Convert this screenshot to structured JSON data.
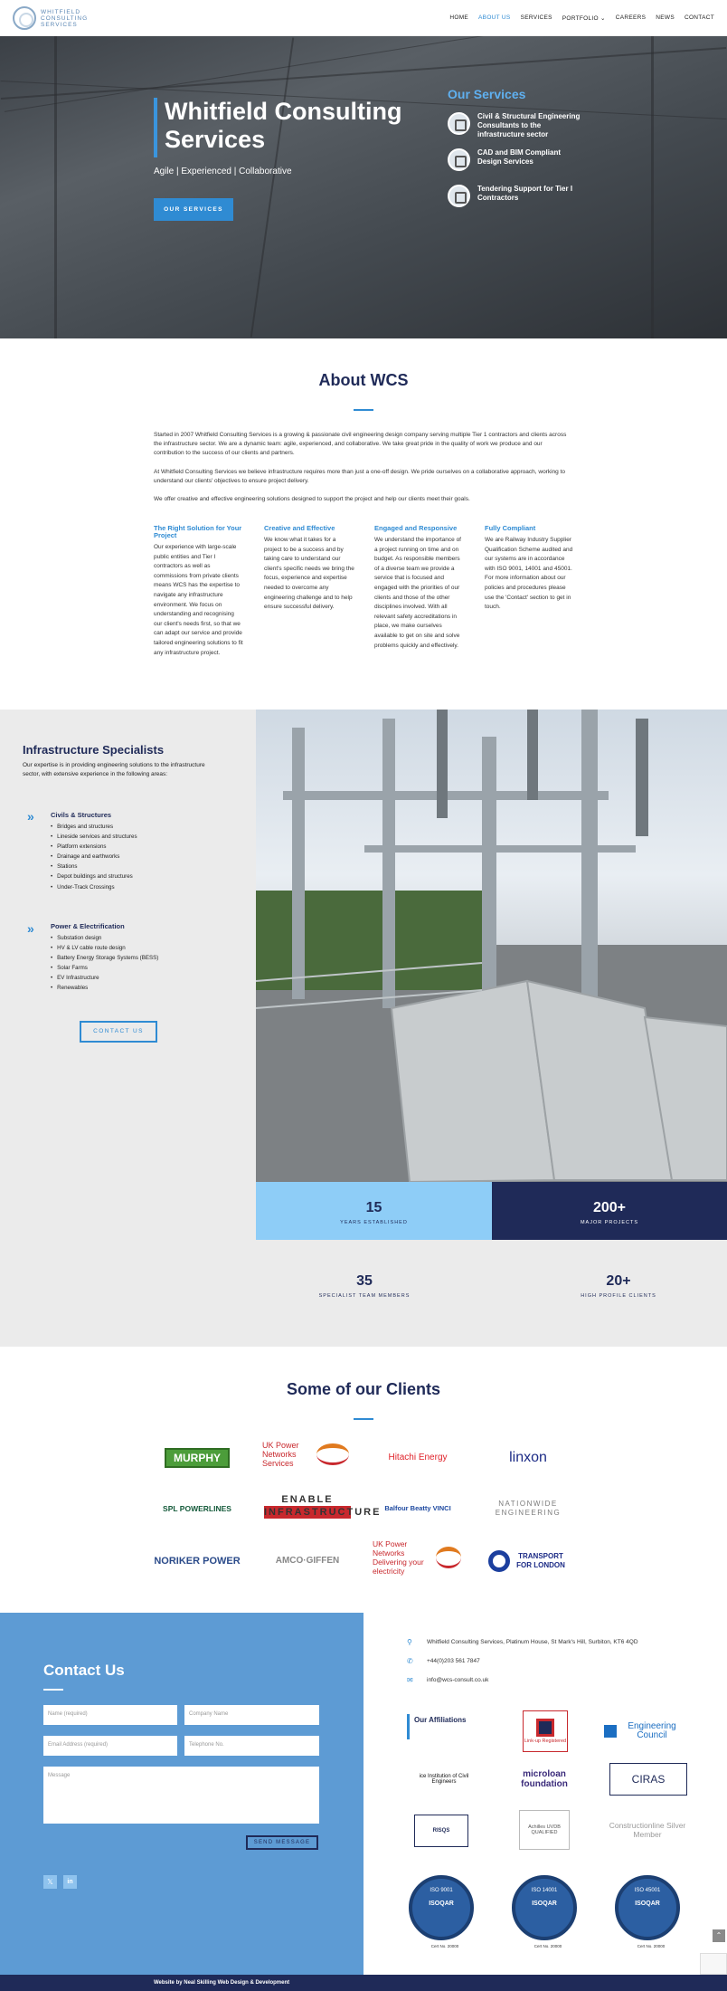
{
  "brand": {
    "logo_line1": "WHITFIELD",
    "logo_line2": "CONSULTING",
    "logo_line3": "SERVICES"
  },
  "nav": [
    "HOME",
    "ABOUT US",
    "SERVICES",
    "PORTFOLIO ⌄",
    "CAREERS",
    "NEWS",
    "CONTACT"
  ],
  "hero": {
    "title": "Whitfield Consulting Services",
    "subtitle": "Agile | Experienced | Collaborative",
    "button": "OUR SERVICES",
    "services_heading": "Our Services",
    "services": [
      "Civil & Structural Engineering Consultants to the infrastructure sector",
      "CAD and BIM Compliant Design Services",
      "Tendering Support for Tier I Contractors"
    ]
  },
  "about": {
    "title": "About WCS",
    "paragraphs": [
      "Started in 2007 Whitfield Consulting Services is a growing & passionate civil engineering design company serving multiple Tier 1 contractors and clients across the infrastructure sector. We are a dynamic team: agile, experienced, and collaborative. We take great pride in the quality of work we produce and our contribution to the success of our clients and partners.",
      "At Whitfield Consulting Services we believe infrastructure requires more than just a one-off design. We pride ourselves on a collaborative approach, working to understand our clients' objectives to ensure project delivery.",
      "We offer creative and effective engineering solutions designed to support the project and help our clients meet their goals."
    ],
    "columns": [
      {
        "title": "The Right Solution for Your Project",
        "text": "Our experience with large-scale public entities and Tier I contractors as well as commissions from private clients means WCS has the expertise to navigate any infrastructure environment. We focus on understanding and recognising our client's needs first, so that we can adapt our service and provide tailored engineering solutions to fit any infrastructure project."
      },
      {
        "title": "Creative and Effective",
        "text": "We know what it takes for a project to be a success and by taking care to understand our client's specific needs we bring the focus, experience and expertise needed to overcome any engineering challenge and to help ensure successful delivery."
      },
      {
        "title": "Engaged and Responsive",
        "text": "We understand the importance of a project running on time and on budget. As responsible members of a diverse team we provide a service that is focused and engaged with the priorities of our clients and those of the other disciplines involved. With all relevant safety accreditations in place, we make ourselves available to get on site and solve problems quickly and effectively."
      },
      {
        "title": "Fully Compliant",
        "text": "We are Railway Industry Supplier Qualification Scheme audited and our systems are in accordance with ISO 9001, 14001 and 45001. For more information about our policies and procedures please use the 'Contact' section to get in touch."
      }
    ]
  },
  "infra": {
    "title": "Infrastructure Specialists",
    "description": "Our expertise is in providing engineering solutions to the infrastructure sector, with extensive experience in the following areas:",
    "groups": [
      {
        "title": "Civils & Structures",
        "items": [
          "Bridges and structures",
          "Lineside services and structures",
          "Platform extensions",
          "Drainage and earthworks",
          "Stations",
          "Depot buildings and structures",
          "Under-Track Crossings"
        ]
      },
      {
        "title": "Power & Electrification",
        "items": [
          "Substation design",
          "HV & LV cable route design",
          "Battery Energy Storage Systems (BESS)",
          "Solar Farms",
          "EV Infrastructure",
          "Renewables"
        ]
      }
    ],
    "button": "CONTACT US"
  },
  "stats": [
    {
      "num": "15",
      "label": "YEARS ESTABLISHED"
    },
    {
      "num": "200+",
      "label": "MAJOR PROJECTS"
    },
    {
      "num": "35",
      "label": "SPECIALIST TEAM MEMBERS"
    },
    {
      "num": "20+",
      "label": "HIGH PROFILE CLIENTS"
    }
  ],
  "clients": {
    "title": "Some of our Clients",
    "logos": [
      "MURPHY",
      "UK Power Networks Services",
      "Hitachi Energy",
      "linxon",
      "SPL POWERLINES",
      "ENABLE INFRASTRUCTURE",
      "Balfour Beatty VINCI",
      "NATIONWIDE ENGINEERING",
      "NORIKER POWER",
      "AMCO·GIFFEN",
      "UK Power Networks Delivering your electricity",
      "TRANSPORT FOR LONDON"
    ]
  },
  "contact": {
    "title": "Contact Us",
    "placeholders": {
      "name": "Name (required)",
      "company": "Company Name",
      "email": "Email Address (required)",
      "phone": "Telephone No.",
      "message": "Message"
    },
    "send": "SEND MESSAGE",
    "address": "Whitfield Consulting Services, Platinum House, St Mark's Hill, Surbiton, KT6 4QD",
    "phone": "+44(0)203 561 7847",
    "email": "info@wcs-consult.co.uk",
    "affiliations_title": "Our Affiliations",
    "affiliations": [
      "Link-up Registered",
      "Engineering Council",
      "ice Institution of Civil Engineers",
      "microloan foundation",
      "CIRAS",
      "RISQS",
      "Achilles UVDB QUALIFIED",
      "Constructionline Silver Member"
    ],
    "iso": [
      {
        "std": "ISO 9001",
        "cert": "Cert No. 20000"
      },
      {
        "std": "ISO 14001",
        "cert": "Cert No. 20000"
      },
      {
        "std": "ISO 45001",
        "cert": "Cert No. 20000"
      }
    ]
  },
  "footer": "Website by Neal Skilling Web Design & Development"
}
